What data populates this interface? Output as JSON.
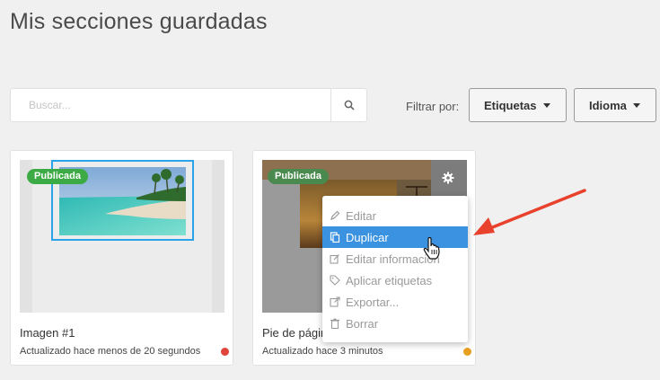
{
  "page": {
    "title": "Mis secciones guardadas"
  },
  "search": {
    "placeholder": "Buscar..."
  },
  "filter": {
    "label": "Filtrar por:",
    "tags_label": "Etiquetas",
    "language_label": "Idioma"
  },
  "cards": [
    {
      "badge": "Publicada",
      "name": "Imagen #1",
      "meta": "Actualizado hace menos de 20 segundos",
      "status_color": "#e0443a"
    },
    {
      "badge": "Publicada",
      "name": "Pie de página",
      "meta": "Actualizado hace 3 minutos",
      "status_color": "#e8a020"
    }
  ],
  "context_menu": {
    "items": [
      {
        "label": "Editar",
        "icon": "pencil-icon",
        "active": false
      },
      {
        "label": "Duplicar",
        "icon": "copy-icon",
        "active": true
      },
      {
        "label": "Editar información",
        "icon": "edit-info-icon",
        "active": false
      },
      {
        "label": "Aplicar etiquetas",
        "icon": "tag-icon",
        "active": false
      },
      {
        "label": "Exportar...",
        "icon": "export-icon",
        "active": false
      },
      {
        "label": "Borrar",
        "icon": "trash-icon",
        "active": false
      }
    ]
  },
  "colors": {
    "accent": "#3a92e0",
    "published_badge": "#3dab45",
    "annotation_arrow": "#e8412c"
  }
}
